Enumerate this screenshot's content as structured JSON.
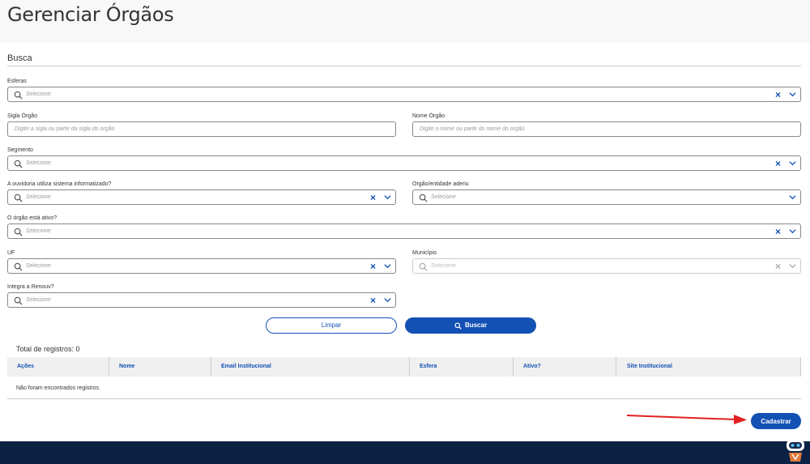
{
  "page": {
    "title": "Gerenciar Órgãos"
  },
  "busca": {
    "title": "Busca"
  },
  "filters": {
    "esferas": {
      "label": "Esferas",
      "placeholder": "Selecione"
    },
    "sigla": {
      "label": "Sigla Órgão",
      "placeholder": "Digite a sigla ou parte da sigla do orgão"
    },
    "nome": {
      "label": "Nome Órgão",
      "placeholder": "Digite o nome ou parte do nome do orgão"
    },
    "segmento": {
      "label": "Segmento",
      "placeholder": "Selecione"
    },
    "ouvidoria": {
      "label": "A ouvidoria utiliza sistema informatizado?",
      "placeholder": "Selecione"
    },
    "aderiu": {
      "label": "Orgão/entidade aderiu",
      "placeholder": "Selecione"
    },
    "ativo": {
      "label": "O órgão está ativo?",
      "placeholder": "Selecione"
    },
    "uf": {
      "label": "UF",
      "placeholder": "Selecione"
    },
    "municipio": {
      "label": "Município",
      "placeholder": "Selecione"
    },
    "renouv": {
      "label": "Integra a Renouv?",
      "placeholder": "Selecione"
    }
  },
  "buttons": {
    "limpar": "Limpar",
    "buscar": "Buscar",
    "cadastrar": "Cadastrar"
  },
  "results": {
    "total": "Total de registros: 0",
    "columns": [
      "Ações",
      "Nome",
      "Email Institucional",
      "Esfera",
      "Ativo?",
      "Site Institucional"
    ],
    "empty": "Não foram encontrados registros."
  },
  "icons": {
    "search": "search-icon",
    "clear": "close-icon",
    "dropdown": "chevron-down-icon",
    "assistant": "robot-icon"
  },
  "colors": {
    "primary": "#1351b4",
    "footer": "#0c2245",
    "annotation": "#e02020"
  }
}
